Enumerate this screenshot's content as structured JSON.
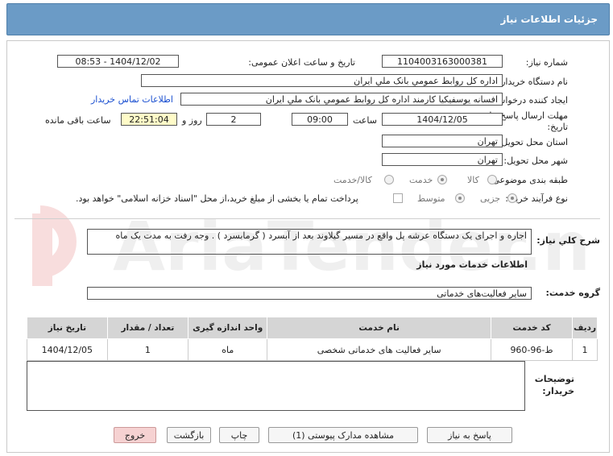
{
  "page": {
    "title": "جزئیات اطلاعات نیاز"
  },
  "form": {
    "need_number": {
      "label": "شماره نیاز:",
      "value": "1104003163000381"
    },
    "announce_date": {
      "label": "تاریخ و ساعت اعلان عمومی:",
      "value": "1404/12/02 - 08:53"
    },
    "buyer_org": {
      "label": "نام دستگاه خریدار:",
      "value": "اداره کل روابط عمومي بانک ملي ايران"
    },
    "requester": {
      "label": "ایجاد کننده درخواست:",
      "value": "افسانه يوسفيکيا کارمند اداره کل روابط عمومي بانک ملي ايران"
    },
    "contact_link": "اطلاعات تماس خریدار",
    "deadline": {
      "label": "مهلت ارسال پاسخ: تا تاریخ:",
      "date": "1404/12/05",
      "time_label": "ساعت",
      "time": "09:00",
      "days": "2",
      "days_label": "روز و",
      "remaining": "22:51:04",
      "remaining_label": "ساعت باقی مانده"
    },
    "province": {
      "label": "استان محل تحویل:",
      "value": "تهران"
    },
    "city": {
      "label": "شهر محل تحویل:",
      "value": "تهران"
    },
    "category": {
      "label": "طبقه بندی موضوعی:",
      "options": [
        "کالا",
        "خدمت",
        "کالا/خدمت"
      ],
      "selected": "خدمت"
    },
    "purchase_type": {
      "label": "نوع فرآیند خرید :",
      "options": [
        "جزیی",
        "متوسط"
      ],
      "selected": "جزیی",
      "treasury_note": "پرداخت تمام یا بخشی از مبلغ خرید،از محل \"اسناد خزانه اسلامی\" خواهد بود."
    },
    "description": {
      "label": "شرح کلي نياز:",
      "value": "اجاره و اجرای  یک دستگاه عرشه پل واقع در مسیر گیلاوند بعد از آبسرد ( گرمابسرد ) . وجه رفت به مدت یک ماه"
    },
    "services_heading": "اطلاعات خدمات مورد نیاز",
    "service_group": {
      "label": "گروه خدمت:",
      "value": "سایر فعالیت‌های خدماتی"
    }
  },
  "table": {
    "headers": [
      "ردیف",
      "کد خدمت",
      "نام خدمت",
      "واحد اندازه گیری",
      "تعداد / مقدار",
      "تاریخ نیاز"
    ],
    "rows": [
      [
        "1",
        "ط-96-960",
        "سایر فعالیت های خدماتی شخصی",
        "ماه",
        "1",
        "1404/12/05"
      ]
    ]
  },
  "buyer_notes": {
    "label": "توضیحات خریدار:",
    "value": ""
  },
  "buttons": {
    "reply": "پاسخ به نیاز",
    "attachments": "مشاهده مدارک پیوستی (1)",
    "print": "چاپ",
    "back": "بازگشت",
    "exit": "خروج"
  },
  "watermark": "AriaTender.net",
  "colors": {
    "titlebar": "#6b9bc6",
    "link": "#1a4fd0",
    "remaining_bg": "#fffbc8",
    "exit_bg": "#f6d2d2"
  }
}
